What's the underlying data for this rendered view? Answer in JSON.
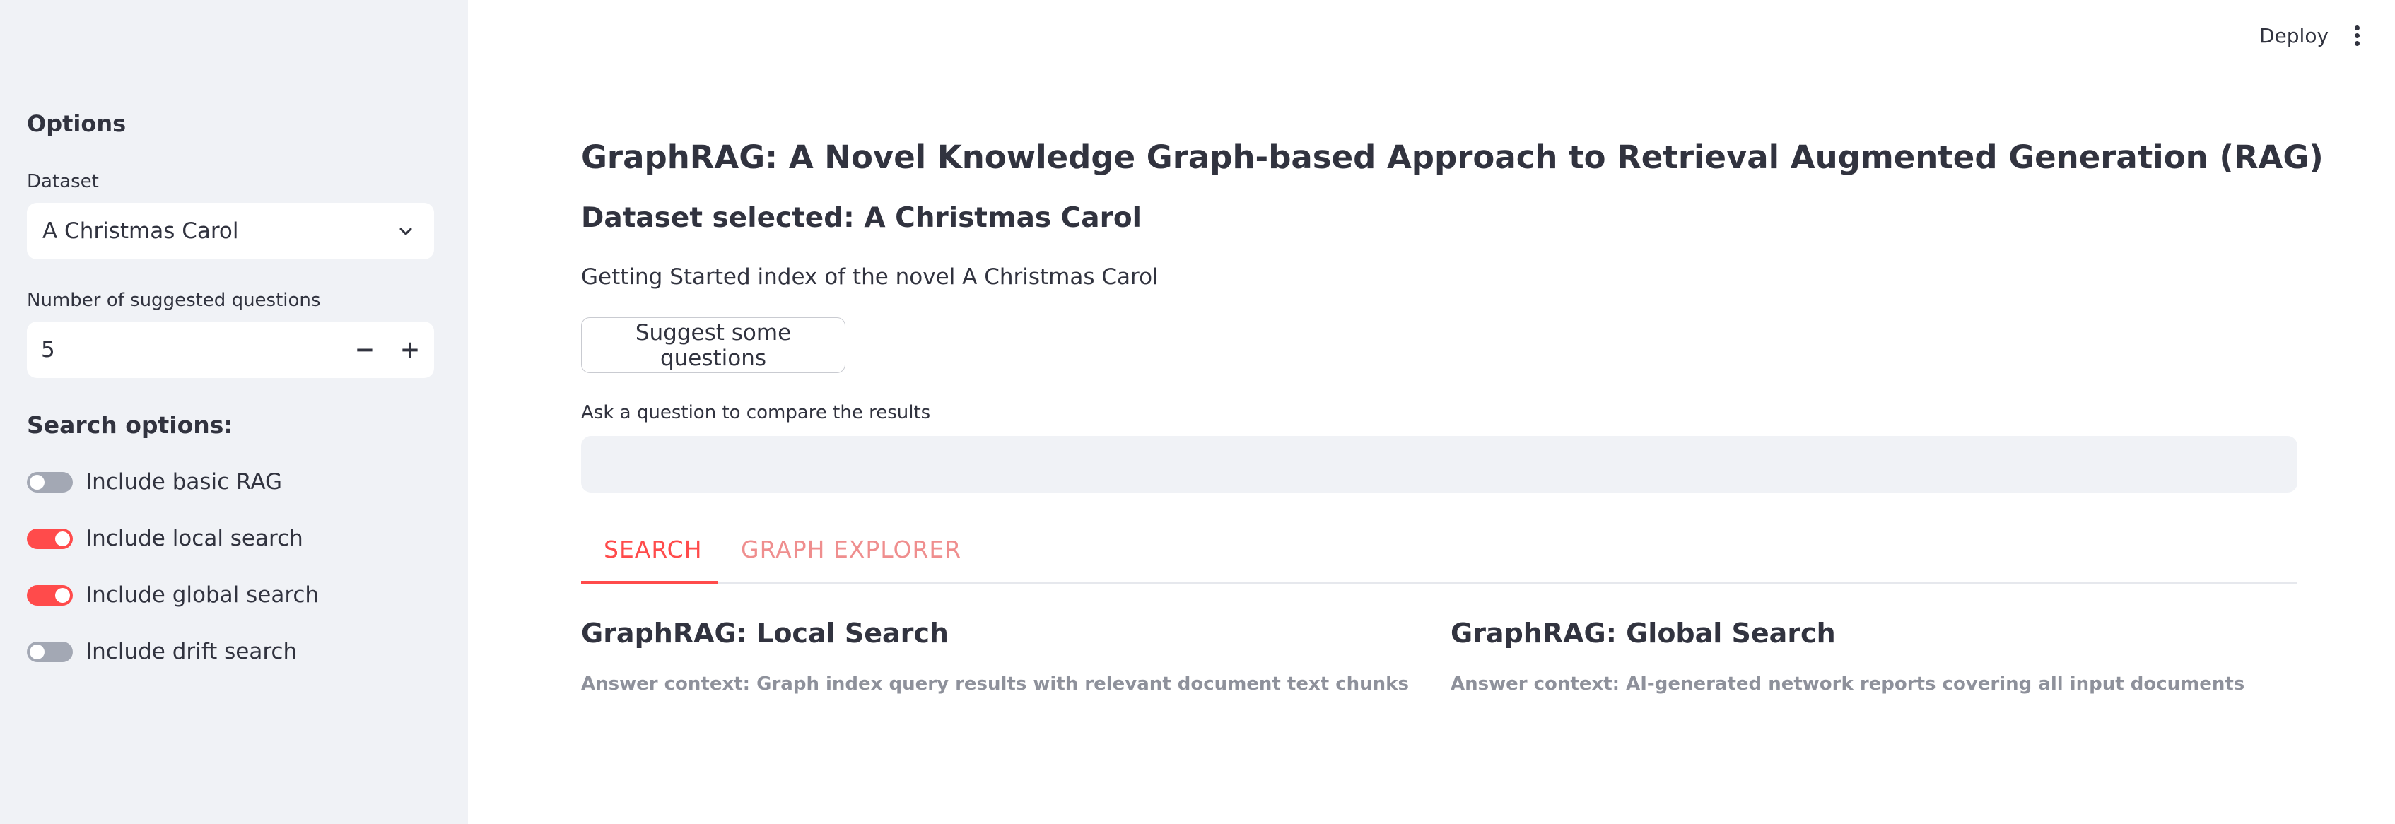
{
  "header": {
    "deploy_label": "Deploy",
    "menu_icon": "kebab-menu-icon"
  },
  "sidebar": {
    "title": "Options",
    "dataset": {
      "label": "Dataset",
      "value": "A Christmas Carol",
      "icon": "chevron-down-icon"
    },
    "num_questions": {
      "label": "Number of suggested questions",
      "value": "5",
      "minus": "−",
      "plus": "+"
    },
    "search_title": "Search options:",
    "toggles": [
      {
        "label": "Include basic RAG",
        "checked": false
      },
      {
        "label": "Include local search",
        "checked": true
      },
      {
        "label": "Include global search",
        "checked": true
      },
      {
        "label": "Include drift search",
        "checked": false
      }
    ]
  },
  "main": {
    "title": "GraphRAG: A Novel Knowledge Graph-based Approach to Retrieval Augmented Generation (RAG)",
    "dataset_selected": "Dataset selected: A Christmas Carol",
    "intro": "Getting Started index of the novel A Christmas Carol",
    "suggest_button": "Suggest some questions",
    "ask_label": "Ask a question to compare the results",
    "ask_value": "",
    "tabs": [
      {
        "label": "SEARCH",
        "active": true
      },
      {
        "label": "GRAPH EXPLORER",
        "active": false
      }
    ],
    "columns": [
      {
        "title": "GraphRAG: Local Search",
        "caption": "Answer context: Graph index query results with relevant document text chunks"
      },
      {
        "title": "GraphRAG: Global Search",
        "caption": "Answer context: AI-generated network reports covering all input documents"
      }
    ]
  },
  "colors": {
    "accent": "#ff4b4b",
    "sidebar_bg": "#f0f2f6",
    "text": "#31333f",
    "muted_text": "#8e919b"
  }
}
